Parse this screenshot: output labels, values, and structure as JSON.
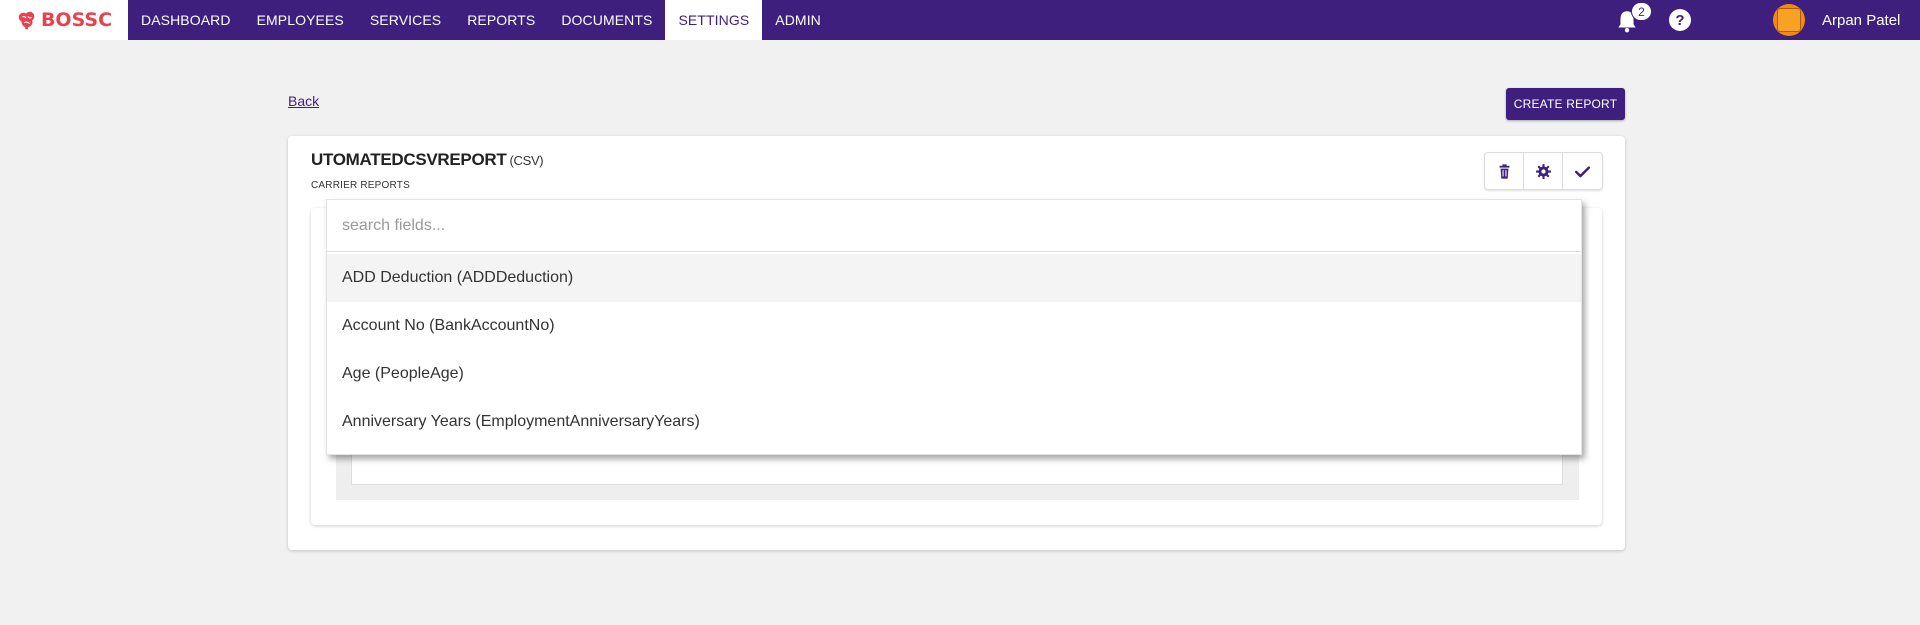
{
  "navbar": {
    "logo_text": "BOSSC",
    "items": [
      "DASHBOARD",
      "EMPLOYEES",
      "SERVICES",
      "REPORTS",
      "DOCUMENTS",
      "SETTINGS",
      "ADMIN"
    ],
    "active_item": "SETTINGS",
    "notification_count": "2",
    "help_label": "?",
    "username": "Arpan Patel"
  },
  "page": {
    "back_label": "Back",
    "create_report_label": "CREATE REPORT"
  },
  "report": {
    "title": "UTOMATEDCSVREPORT",
    "type": "(CSV)",
    "category": "CARRIER REPORTS",
    "actions": [
      "trash-icon",
      "gear-icon",
      "check-icon"
    ]
  },
  "field_picker": {
    "placeholder": "search fields...",
    "options": [
      "ADD Deduction (ADDDeduction)",
      "Account No (BankAccountNo)",
      "Age (PeopleAge)",
      "Anniversary Years (EmploymentAnniversaryYears)"
    ],
    "highlighted_index": 0
  },
  "colors": {
    "brand_purple": "#3f1f7e",
    "logo_red": "#e8424e",
    "avatar_orange": "#ef8a12",
    "page_background": "#f1f1f1"
  }
}
